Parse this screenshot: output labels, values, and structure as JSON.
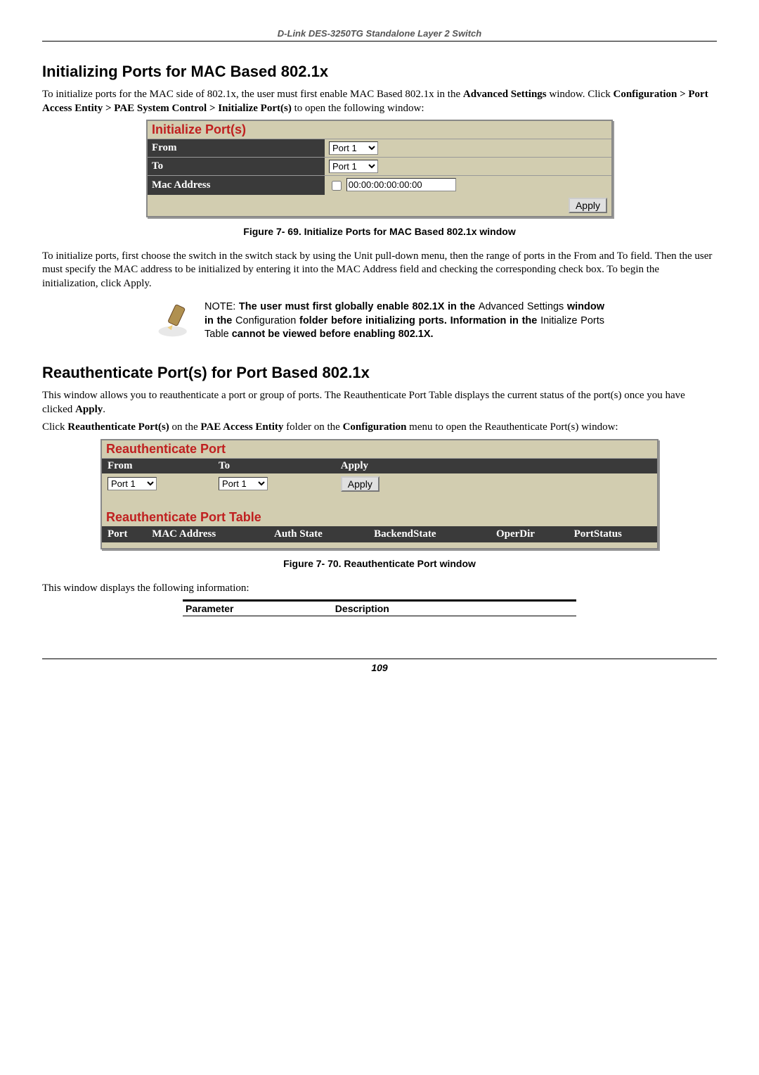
{
  "header": "D-Link DES-3250TG Standalone Layer 2 Switch",
  "section1": {
    "heading": "Initializing Ports for MAC Based 802.1x",
    "intro_prefix": "To initialize ports for the MAC side of 802.1x, the user must first enable MAC Based 802.1x in the ",
    "intro_bold1": "Advanced Settings",
    "intro_mid": " window. Click ",
    "intro_bold2": "Configuration > Port Access Entity > PAE System Control > Initialize Port(s)",
    "intro_suffix": " to open the following window:",
    "widget": {
      "title": "Initialize Port(s)",
      "from_label": "From",
      "from_value": "Port 1",
      "to_label": "To",
      "to_value": "Port 1",
      "mac_label": "Mac Address",
      "mac_value": "00:00:00:00:00:00",
      "apply": "Apply"
    },
    "caption": "Figure 7- 69. Initialize Ports for MAC Based 802.1x window",
    "para2": "To initialize ports, first choose the switch in the switch stack by using the Unit pull-down menu, then the range of ports in the From and To field. Then the user must specify the MAC address to be initialized by entering it into the MAC Address field and checking the corresponding check box. To begin the initialization, click Apply.",
    "note": {
      "prefix": "NOTE: ",
      "bold1": "The user must first globally enable 802.1X in the ",
      "plain1": "Advanced Settings ",
      "bold2": "window in the ",
      "plain2": "Configuration ",
      "bold3": "folder before initializing ports. Information in the ",
      "plain3": "Initialize Ports Table ",
      "bold4": "cannot be viewed before enabling 802.1X."
    }
  },
  "section2": {
    "heading": "Reauthenticate Port(s) for Port Based 802.1x",
    "intro_prefix": "This window allows you to reauthenticate a port or group of ports. The Reauthenticate Port Table displays the current status of the port(s) once you have clicked ",
    "intro_bold": "Apply",
    "intro_suffix": ".",
    "para2_prefix": "Click ",
    "para2_b1": "Reauthenticate Port(s)",
    "para2_mid1": " on the ",
    "para2_b2": "PAE Access Entity",
    "para2_mid2": " folder on the ",
    "para2_b3": "Configuration",
    "para2_suffix": " menu to open the Reauthenticate Port(s) window:",
    "widget": {
      "title1": "Reauthenticate Port",
      "from_label": "From",
      "to_label": "To",
      "apply_label": "Apply",
      "from_value": "Port 1",
      "to_value": "Port 1",
      "apply_btn": "Apply",
      "title2": "Reauthenticate Port Table",
      "cols": {
        "c1": "Port",
        "c2": "MAC Address",
        "c3": "Auth State",
        "c4": "BackendState",
        "c5": "OperDir",
        "c6": "PortStatus"
      }
    },
    "caption": "Figure 7- 70.  Reauthenticate Port window",
    "after": "This window displays the following information:",
    "param_table": {
      "h1": "Parameter",
      "h2": "Description"
    }
  },
  "page_number": "109"
}
